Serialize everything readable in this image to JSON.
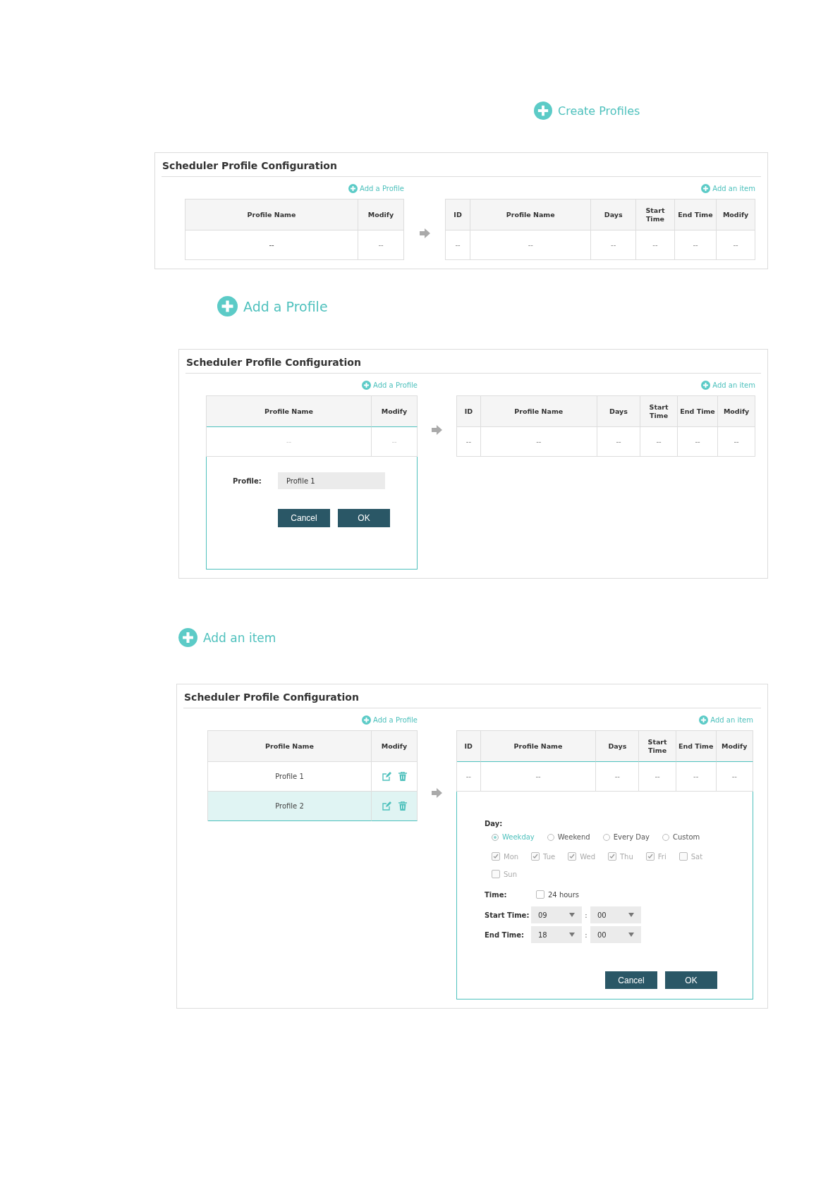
{
  "sections": [
    {
      "heading": "Create Profiles",
      "panel": {
        "title": "Scheduler Profile Configuration",
        "add_profile": "Add a Profile",
        "add_item": "Add an item",
        "profile_table": {
          "columns": [
            "Profile Name",
            "Modify"
          ],
          "rows": [
            {
              "kind": "empty",
              "name": "--",
              "modify": "--",
              "selected": false,
              "disabled": false
            }
          ]
        },
        "item_table": {
          "columns": [
            "ID",
            "Profile Name",
            "Days",
            "Start Time",
            "End Time",
            "Modify"
          ],
          "rows": [
            {
              "cells": [
                "--",
                "--",
                "--",
                "--",
                "--",
                "--"
              ]
            }
          ]
        }
      }
    },
    {
      "heading": "Add a Profile",
      "panel": {
        "title": "Scheduler Profile Configuration",
        "add_profile": "Add a Profile",
        "add_item": "Add an item",
        "profile_table": {
          "columns": [
            "Profile Name",
            "Modify"
          ],
          "rows": [
            {
              "kind": "empty",
              "name": "--",
              "modify": "--",
              "selected": false,
              "disabled": true
            }
          ],
          "profile_form": {
            "label": "Profile:",
            "value": "Profile 1",
            "buttons": [
              "Cancel",
              "OK"
            ]
          }
        },
        "item_table": {
          "columns": [
            "ID",
            "Profile Name",
            "Days",
            "Start Time",
            "End Time",
            "Modify"
          ],
          "rows": [
            {
              "cells": [
                "--",
                "--",
                "--",
                "--",
                "--",
                "--"
              ]
            }
          ]
        }
      }
    },
    {
      "heading": "Add an item",
      "panel": {
        "title": "Scheduler Profile Configuration",
        "add_profile": "Add a Profile",
        "add_item": "Add an item",
        "profile_table": {
          "columns": [
            "Profile Name",
            "Modify"
          ],
          "rows": [
            {
              "kind": "profile",
              "name": "Profile 1",
              "selected": false,
              "disabled": false
            },
            {
              "kind": "profile",
              "name": "Profile 2",
              "selected": true,
              "disabled": false
            }
          ]
        },
        "item_table": {
          "columns": [
            "ID",
            "Profile Name",
            "Days",
            "Start Time",
            "End Time",
            "Modify"
          ],
          "rows": [
            {
              "cells": [
                "--",
                "--",
                "--",
                "--",
                "--",
                "--"
              ]
            }
          ],
          "item_form": {
            "day_label": "Day:",
            "day_options": [
              {
                "label": "Weekday",
                "selected": true
              },
              {
                "label": "Weekend",
                "selected": false
              },
              {
                "label": "Every Day",
                "selected": false
              },
              {
                "label": "Custom",
                "selected": false
              }
            ],
            "days": [
              {
                "label": "Mon",
                "checked": true,
                "disabled": true
              },
              {
                "label": "Tue",
                "checked": true,
                "disabled": true
              },
              {
                "label": "Wed",
                "checked": true,
                "disabled": true
              },
              {
                "label": "Thu",
                "checked": true,
                "disabled": true
              },
              {
                "label": "Fri",
                "checked": true,
                "disabled": true
              },
              {
                "label": "Sat",
                "checked": false,
                "disabled": true
              },
              {
                "label": "Sun",
                "checked": false,
                "disabled": true
              }
            ],
            "time_label": "Time:",
            "all_day": {
              "label": "24 hours",
              "checked": false
            },
            "times": [
              {
                "label": "Start Time:",
                "hour": "09",
                "separator": ":",
                "minute": "00"
              },
              {
                "label": "End Time:",
                "hour": "18",
                "separator": ":",
                "minute": "00"
              }
            ],
            "buttons": [
              "Cancel",
              "OK"
            ]
          }
        }
      }
    }
  ]
}
